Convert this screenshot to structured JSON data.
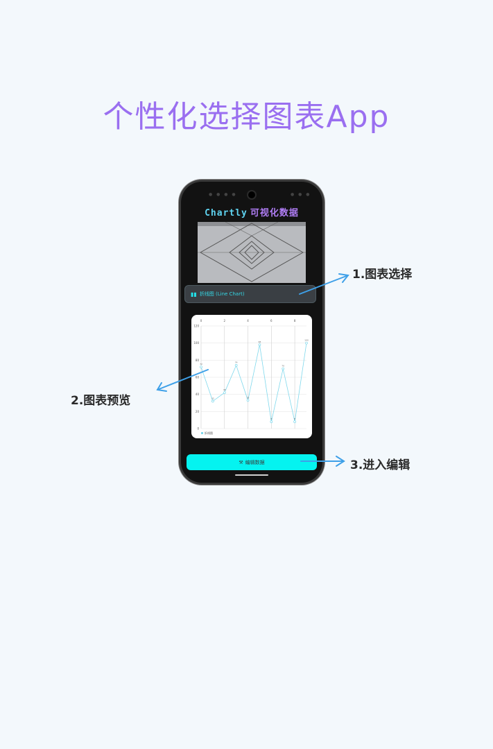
{
  "headline": "个性化选择图表App",
  "app": {
    "title_latin": "Chartly",
    "title_cn": "可视化数据",
    "chart_selector_label": "折线图 (Line Chart)",
    "edit_button_label": "编辑数据"
  },
  "icons": {
    "chart_selector": "bar-chart-icon",
    "edit_button": "edit-tools-icon"
  },
  "colors": {
    "headline": "#9a6ff0",
    "accent_cyan": "#05f3f0",
    "annotation_arrow": "#3ea0e8",
    "line_series": "#7fd8ec"
  },
  "callouts": [
    {
      "label": "1.图表选择"
    },
    {
      "label": "2.图表预览"
    },
    {
      "label": "3.进入编辑"
    }
  ],
  "chart_data": {
    "type": "line",
    "x": [
      0,
      1,
      2,
      3,
      4,
      5,
      6,
      7,
      8,
      9
    ],
    "x_tick_labels": [
      "0",
      "2",
      "4",
      "6",
      "8"
    ],
    "y_tick_labels": [
      "0",
      "20",
      "40",
      "60",
      "80",
      "100",
      "120"
    ],
    "ylim": [
      0,
      120
    ],
    "series": [
      {
        "name": "折线图",
        "values": [
          72,
          32,
          42,
          74,
          33,
          98,
          8,
          70,
          8,
          100
        ]
      }
    ],
    "legend_position": "bottom-left",
    "grid": true
  }
}
